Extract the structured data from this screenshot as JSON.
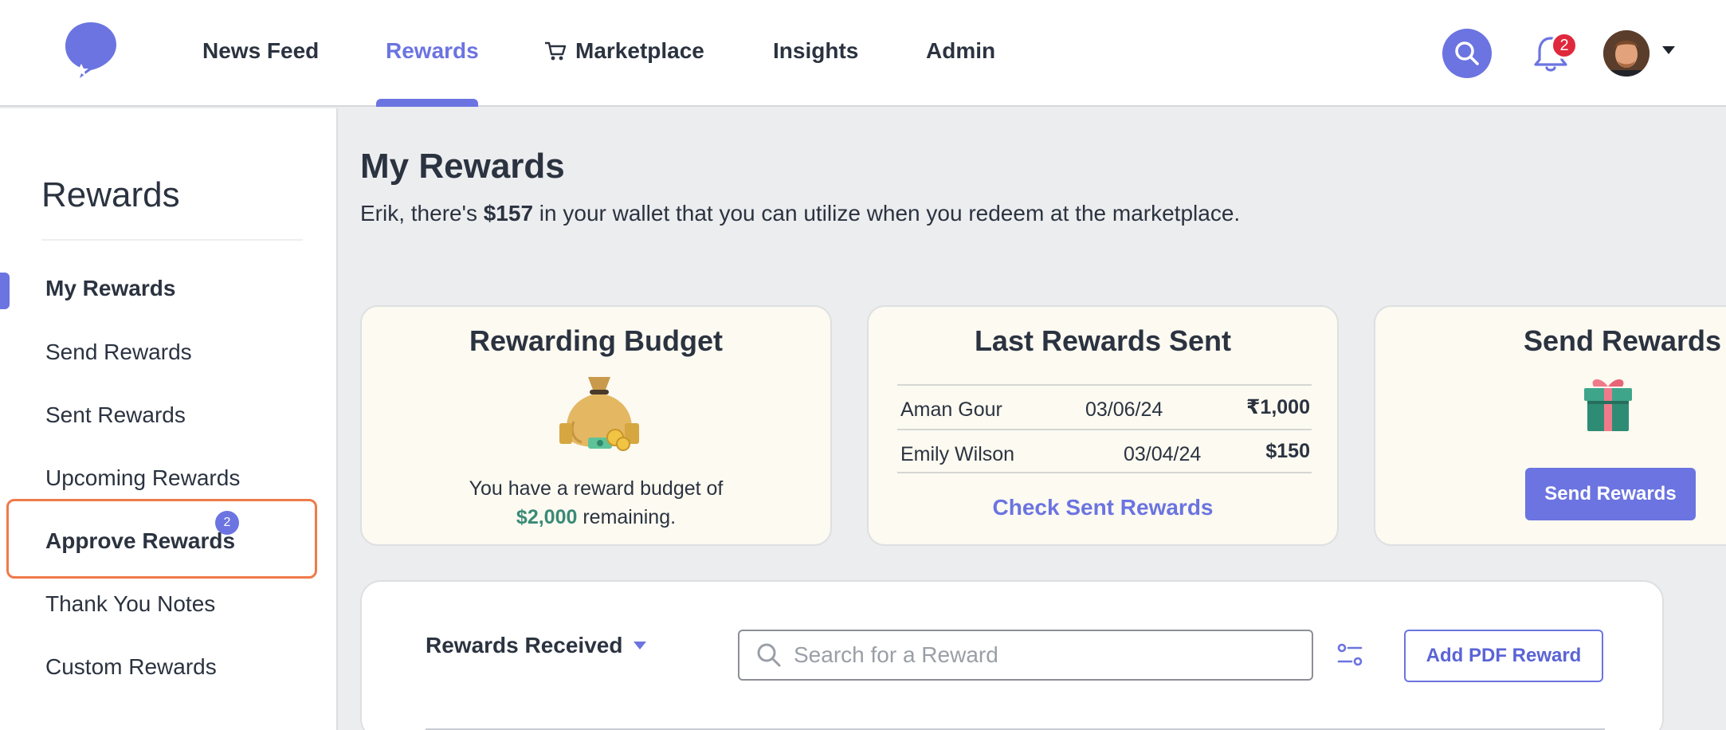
{
  "nav": {
    "items": [
      {
        "label": "News Feed"
      },
      {
        "label": "Rewards"
      },
      {
        "label": "Marketplace"
      },
      {
        "label": "Insights"
      },
      {
        "label": "Admin"
      }
    ],
    "notification_count": "2",
    "accent_color": "#6b74e0"
  },
  "sidebar": {
    "title": "Rewards",
    "items": [
      {
        "label": "My Rewards"
      },
      {
        "label": "Send Rewards"
      },
      {
        "label": "Sent Rewards"
      },
      {
        "label": "Upcoming Rewards"
      },
      {
        "label": "Approve Rewards",
        "badge": "2"
      },
      {
        "label": "Thank You Notes"
      },
      {
        "label": "Custom Rewards"
      }
    ]
  },
  "main": {
    "title": "My Rewards",
    "subtitle_prefix": "Erik, there's ",
    "subtitle_amount": "$157",
    "subtitle_suffix": " in your wallet that you can utilize when you redeem at the marketplace."
  },
  "cards": {
    "budget": {
      "title": "Rewarding Budget",
      "text_prefix": "You have a reward budget of",
      "amount": "$2,000",
      "text_suffix": " remaining."
    },
    "last_sent": {
      "title": "Last Rewards Sent",
      "rows": [
        {
          "name": "Aman Gour",
          "date": "03/06/24",
          "amount": "₹1,000"
        },
        {
          "name": "Emily Wilson",
          "date": "03/04/24",
          "amount": "$150"
        }
      ],
      "link_label": "Check Sent Rewards"
    },
    "send": {
      "title": "Send Rewards",
      "button_label": "Send Rewards"
    }
  },
  "received": {
    "dropdown_label": "Rewards Received",
    "search_placeholder": "Search for a Reward",
    "add_pdf_label": "Add PDF Reward"
  }
}
